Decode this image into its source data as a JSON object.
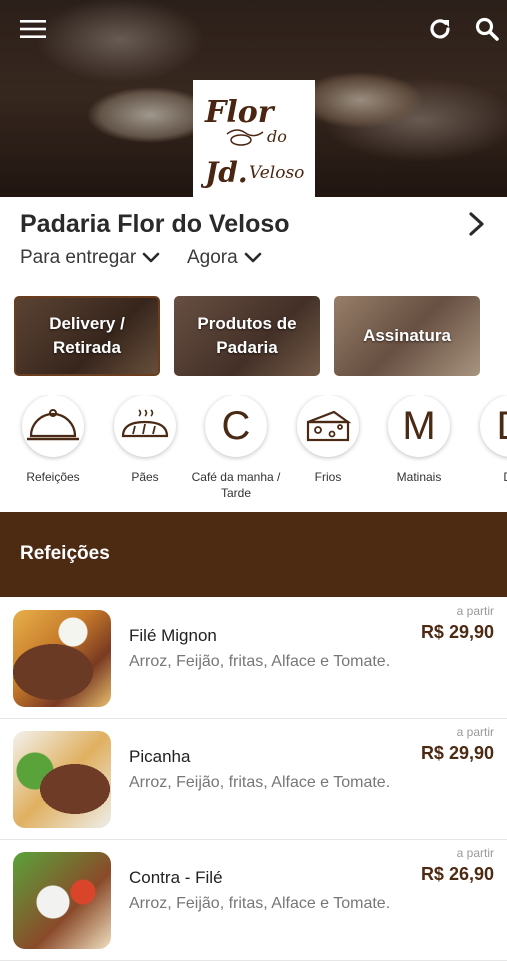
{
  "header": {
    "menu_icon": "hamburger-menu-icon",
    "refresh_icon": "refresh-icon",
    "search_icon": "search-icon",
    "logo_text": "Flor do Jd.Veloso"
  },
  "store": {
    "name": "Padaria Flor do Veloso",
    "delivery_option": "Para entregar",
    "time_option": "Agora"
  },
  "feature_cards": [
    {
      "line1": "Delivery /",
      "line2": "Retirada"
    },
    {
      "line1": "Produtos de",
      "line2": "Padaria"
    },
    {
      "line1": "Assinatura",
      "line2": ""
    }
  ],
  "categories": [
    {
      "label": "Refeições",
      "icon": "cloche-icon"
    },
    {
      "label": "Pães",
      "icon": "bread-icon"
    },
    {
      "label": "Café da manha / Tarde",
      "letter": "C"
    },
    {
      "label": "Frios",
      "icon": "cheese-icon"
    },
    {
      "label": "Matinais",
      "letter": "M"
    },
    {
      "label": "Do",
      "letter": "D"
    }
  ],
  "section": {
    "title": "Refeições"
  },
  "menu_items": [
    {
      "name": "Filé Mignon",
      "description": "Arroz, Feijão, fritas, Alface e Tomate.",
      "price_prefix": "a partir",
      "price": "R$ 29,90"
    },
    {
      "name": "Picanha",
      "description": "Arroz, Feijão, fritas, Alface e Tomate.",
      "price_prefix": "a partir",
      "price": "R$ 29,90"
    },
    {
      "name": "Contra - Filé",
      "description": "Arroz, Feijão, fritas, Alface e Tomate.",
      "price_prefix": "a partir",
      "price": "R$ 26,90"
    }
  ],
  "colors": {
    "brand": "#4d2a12",
    "price": "#4d2a12"
  }
}
